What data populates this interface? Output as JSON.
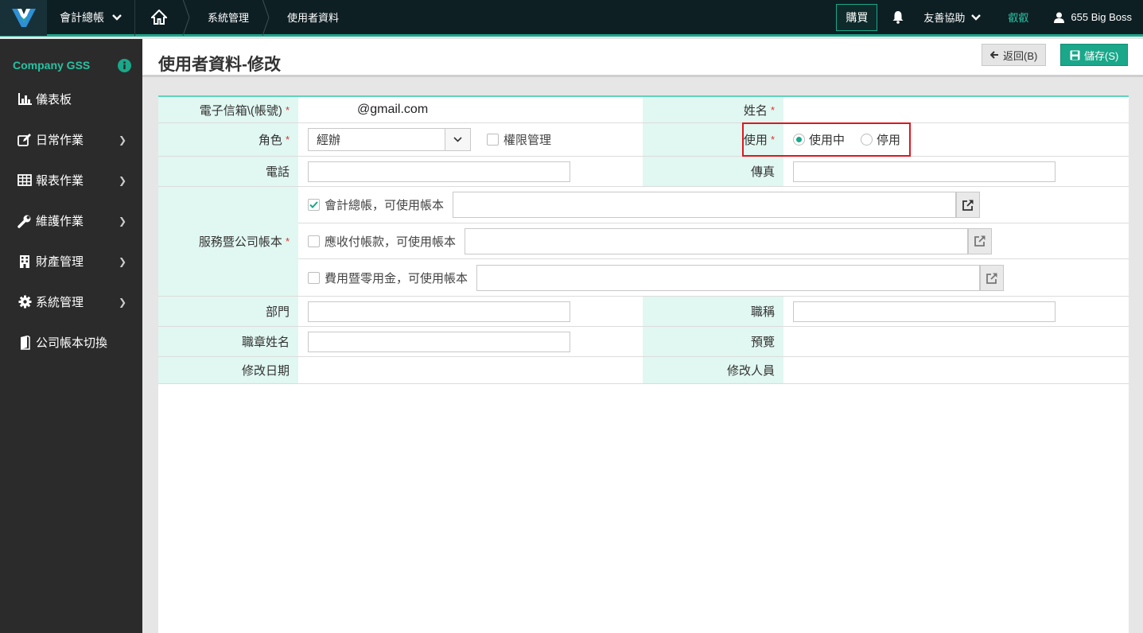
{
  "topbar": {
    "app_name": "會計總帳",
    "breadcrumbs": [
      "系統管理",
      "使用者資料"
    ],
    "buy_label": "購買",
    "help_label": "友善協助",
    "hello_label": "叡叡",
    "user_label": "655 Big Boss",
    "accent_color": "#1aa78a"
  },
  "sidebar": {
    "company": "Company GSS",
    "items": [
      {
        "label": "儀表板",
        "icon": "bar-chart-icon",
        "has_children": false
      },
      {
        "label": "日常作業",
        "icon": "edit-icon",
        "has_children": true
      },
      {
        "label": "報表作業",
        "icon": "table-icon",
        "has_children": true
      },
      {
        "label": "維護作業",
        "icon": "wrench-icon",
        "has_children": true
      },
      {
        "label": "財產管理",
        "icon": "building-icon",
        "has_children": true
      },
      {
        "label": "系統管理",
        "icon": "gear-icon",
        "has_children": true
      },
      {
        "label": "公司帳本切換",
        "icon": "book-icon",
        "has_children": false
      }
    ]
  },
  "page": {
    "title": "使用者資料-修改",
    "back_label": "返回(B)",
    "save_label": "儲存(S)"
  },
  "form": {
    "email_label": "電子信箱\\(帳號)",
    "email_value": "@gmail.com",
    "name_label": "姓名",
    "role_label": "角色",
    "role_value": "經辦",
    "perm_label": "權限管理",
    "use_label": "使用",
    "use_active": "使用中",
    "use_inactive": "停用",
    "phone_label": "電話",
    "fax_label": "傳真",
    "books_label": "服務暨公司帳本",
    "book1_label": "會計總帳，可使用帳本",
    "book2_label": "應收付帳款，可使用帳本",
    "book3_label": "費用暨零用金，可使用帳本",
    "dept_label": "部門",
    "jobtitle_label": "職稱",
    "stamp_label": "職章姓名",
    "preview_label": "預覽",
    "moddate_label": "修改日期",
    "moduser_label": "修改人員",
    "required_mark": "*"
  }
}
